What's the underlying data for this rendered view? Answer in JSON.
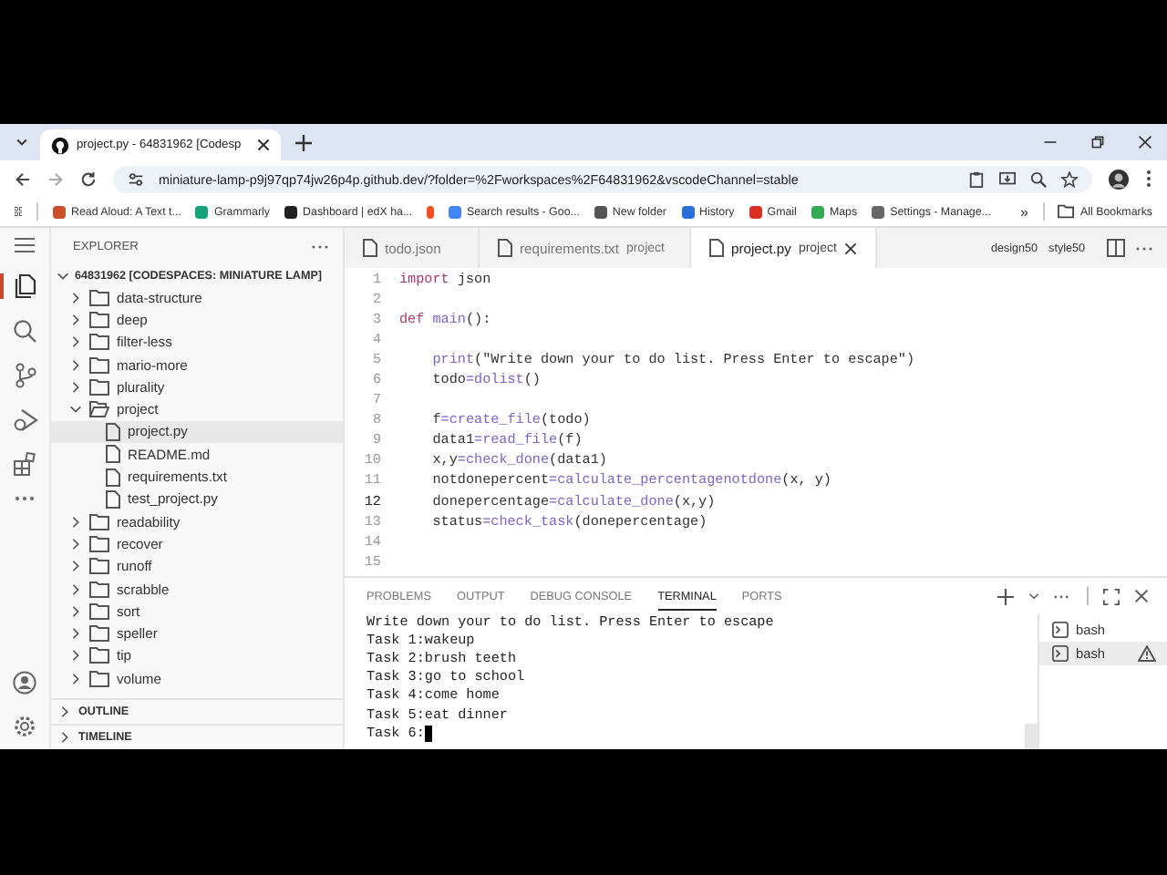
{
  "browser": {
    "tab_title": "project.py - 64831962 [Codesp",
    "url": "miniature-lamp-p9j97qp74jw26p4p.github.dev/?folder=%2Fworkspaces%2F64831962&vscodeChannel=stable",
    "bookmarks": [
      {
        "label": "Read Aloud: A Text t...",
        "color": "#c8502a"
      },
      {
        "label": "Grammarly",
        "color": "#15a37a"
      },
      {
        "label": "Dashboard | edX ha...",
        "color": "#222222"
      },
      {
        "color": "#f25022"
      },
      {
        "label": "Search results - Goo...",
        "color": "#4285f4"
      },
      {
        "label": "New folder",
        "color": "#555555"
      },
      {
        "label": "History",
        "color": "#2b6fd6"
      },
      {
        "label": "Gmail",
        "color": "#d93025"
      },
      {
        "label": "Maps",
        "color": "#34a853"
      },
      {
        "label": "Settings - Manage...",
        "color": "#666666"
      }
    ],
    "more": "»",
    "all_bookmarks": "All Bookmarks"
  },
  "explorer": {
    "title": "EXPLORER",
    "root": "64831962 [CODESPACES: MINIATURE LAMP]",
    "items": [
      {
        "label": "data-structure",
        "kind": "folder",
        "expanded": false
      },
      {
        "label": "deep",
        "kind": "folder",
        "expanded": false
      },
      {
        "label": "filter-less",
        "kind": "folder",
        "expanded": false
      },
      {
        "label": "mario-more",
        "kind": "folder",
        "expanded": false
      },
      {
        "label": "plurality",
        "kind": "folder",
        "expanded": false
      },
      {
        "label": "project",
        "kind": "folder",
        "expanded": true,
        "children": [
          {
            "label": "project.py",
            "kind": "file",
            "selected": true
          },
          {
            "label": "README.md",
            "kind": "file",
            "selected": false
          },
          {
            "label": "requirements.txt",
            "kind": "file",
            "selected": false
          },
          {
            "label": "test_project.py",
            "kind": "file",
            "selected": false
          }
        ]
      },
      {
        "label": "readability",
        "kind": "folder",
        "expanded": false
      },
      {
        "label": "recover",
        "kind": "folder",
        "expanded": false
      },
      {
        "label": "runoff",
        "kind": "folder",
        "expanded": false
      },
      {
        "label": "scrabble",
        "kind": "folder",
        "expanded": false
      },
      {
        "label": "sort",
        "kind": "folder",
        "expanded": false
      },
      {
        "label": "speller",
        "kind": "folder",
        "expanded": false
      },
      {
        "label": "tip",
        "kind": "folder",
        "expanded": false
      },
      {
        "label": "volume",
        "kind": "folder",
        "expanded": false
      }
    ],
    "sections": [
      "OUTLINE",
      "TIMELINE"
    ]
  },
  "editor": {
    "tabs": [
      {
        "label": "todo.json",
        "selected": false
      },
      {
        "label": "requirements.txt",
        "folder": "project",
        "selected": false
      },
      {
        "label": "project.py",
        "folder": "project",
        "selected": true
      }
    ],
    "actions": [
      "design50",
      "style50"
    ],
    "lines": [
      {
        "number": "1",
        "active": false,
        "tokens": [
          {
            "kind": "kw",
            "text": "import"
          },
          {
            "kind": "plain",
            "text": " json"
          }
        ]
      },
      {
        "number": "2",
        "active": false
      },
      {
        "number": "3",
        "active": false,
        "tokens": [
          {
            "kind": "kw",
            "text": "def"
          },
          {
            "kind": "fn",
            "text": " main"
          },
          {
            "kind": "plain",
            "text": "():"
          }
        ]
      },
      {
        "number": "4",
        "active": false
      },
      {
        "number": "5",
        "active": false,
        "tokens": [
          {
            "kind": "fn",
            "text": "    print"
          },
          {
            "kind": "plain",
            "text": "(\"Write down your to do list. Press Enter to escape\")"
          }
        ]
      },
      {
        "number": "6",
        "active": false,
        "tokens": [
          {
            "kind": "plain",
            "text": "    todo"
          },
          {
            "kind": "fn",
            "text": "=dolist"
          },
          {
            "kind": "plain",
            "text": "()"
          }
        ]
      },
      {
        "number": "7",
        "active": false
      },
      {
        "number": "8",
        "active": false,
        "tokens": [
          {
            "kind": "plain",
            "text": "    f"
          },
          {
            "kind": "fn",
            "text": "=create_file"
          },
          {
            "kind": "plain",
            "text": "(todo)"
          }
        ]
      },
      {
        "number": "9",
        "active": false,
        "tokens": [
          {
            "kind": "plain",
            "text": "    data1"
          },
          {
            "kind": "fn",
            "text": "=read_file"
          },
          {
            "kind": "plain",
            "text": "(f)"
          }
        ]
      },
      {
        "number": "10",
        "active": false,
        "tokens": [
          {
            "kind": "plain",
            "text": "    x,y"
          },
          {
            "kind": "fn",
            "text": "=check_done"
          },
          {
            "kind": "plain",
            "text": "(data1)"
          }
        ]
      },
      {
        "number": "11",
        "active": false,
        "tokens": [
          {
            "kind": "plain",
            "text": "    notdonepercent"
          },
          {
            "kind": "fn",
            "text": "=calculate_percentagenotdone"
          },
          {
            "kind": "plain",
            "text": "(x, y)"
          }
        ]
      },
      {
        "number": "12",
        "active": true,
        "tokens": [
          {
            "kind": "plain",
            "text": "    donepercentage"
          },
          {
            "kind": "fn",
            "text": "=calculate_done"
          },
          {
            "kind": "plain",
            "text": "(x,y)"
          }
        ]
      },
      {
        "number": "13",
        "active": false,
        "tokens": [
          {
            "kind": "plain",
            "text": "    status"
          },
          {
            "kind": "fn",
            "text": "=check_task"
          },
          {
            "kind": "plain",
            "text": "(donepercentage)"
          }
        ]
      },
      {
        "number": "14",
        "active": false
      },
      {
        "number": "15",
        "active": false
      }
    ]
  },
  "panel": {
    "tabs": [
      {
        "label": "PROBLEMS",
        "selected": false
      },
      {
        "label": "OUTPUT",
        "selected": false
      },
      {
        "label": "DEBUG CONSOLE",
        "selected": false
      },
      {
        "label": "TERMINAL",
        "selected": true
      },
      {
        "label": "PORTS",
        "selected": false
      }
    ],
    "terminal": [
      "Write down your to do list. Press Enter to escape",
      "Task 1:wakeup",
      "Task 2:brush teeth",
      "Task 3:go to school",
      "Task 4:come home",
      "Task 5:eat dinner",
      "Task 6:"
    ],
    "sessions": [
      {
        "label": "bash",
        "selected": false,
        "warning": false
      },
      {
        "label": "bash",
        "selected": true,
        "warning": true
      }
    ]
  }
}
